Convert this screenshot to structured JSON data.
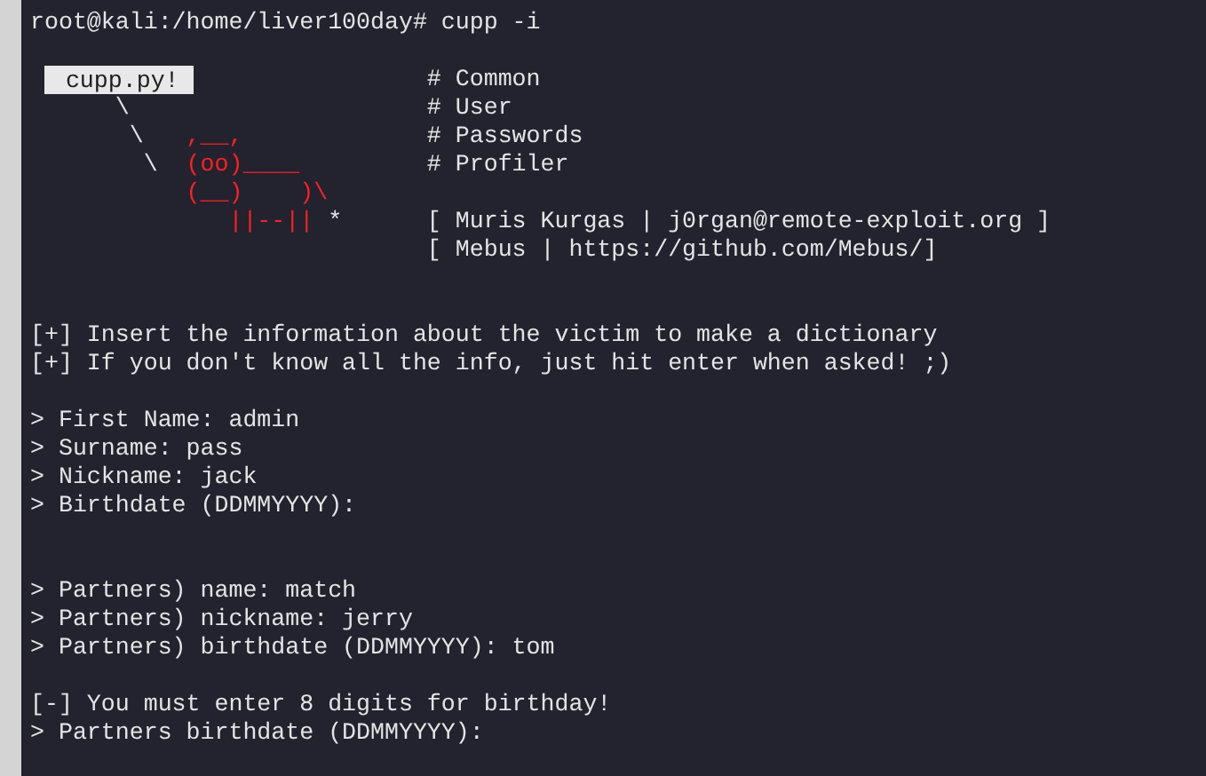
{
  "command_line": "root@kali:/home/liver100day# cupp -i",
  "banner": {
    "label": "cupp.py!",
    "rows": [
      {
        "art": [],
        "info": "# Common"
      },
      {
        "art": [
          {
            "text": "      \\",
            "kind": "plain"
          }
        ],
        "info": "# User"
      },
      {
        "art": [
          {
            "text": "       \\   ",
            "kind": "plain"
          },
          {
            "text": ",__,",
            "kind": "cow"
          }
        ],
        "info": "# Passwords"
      },
      {
        "art": [
          {
            "text": "        \\  ",
            "kind": "plain"
          },
          {
            "text": "(oo)____",
            "kind": "cow"
          }
        ],
        "info": "# Profiler"
      },
      {
        "art": [
          {
            "text": "           (__)    )\\",
            "kind": "cow"
          }
        ]
      },
      {
        "art": [
          {
            "text": "              ||--||",
            "kind": "cow"
          },
          {
            "text": " *",
            "kind": "plain"
          }
        ],
        "info": "[ Muris Kurgas | j0rgan@remote-exploit.org ]"
      },
      {
        "art": [],
        "info": "[ Mebus | https://github.com/Mebus/]"
      }
    ]
  },
  "notices": [
    "[+] Insert the information about the victim to make a dictionary",
    "[+] If you don't know all the info, just hit enter when asked! ;)"
  ],
  "prompts": [
    "> First Name: admin",
    "> Surname: pass",
    "> Nickname: jack",
    "> Birthdate (DDMMYYYY):"
  ],
  "partner_prompts": [
    "> Partners) name: match",
    "> Partners) nickname: jerry",
    "> Partners) birthdate (DDMMYYYY): tom"
  ],
  "error_lines": [
    "[-] You must enter 8 digits for birthday!",
    "> Partners birthdate (DDMMYYYY):"
  ]
}
